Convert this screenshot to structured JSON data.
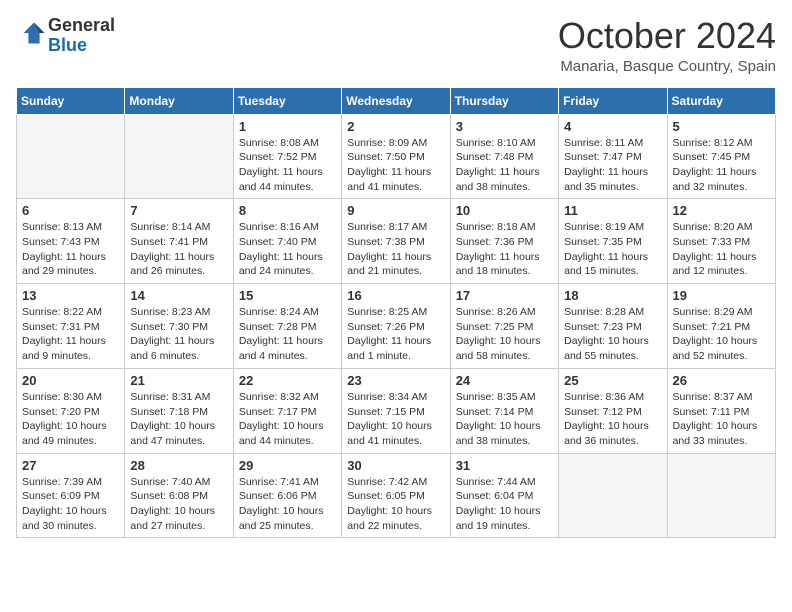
{
  "header": {
    "logo": {
      "line1": "General",
      "line2": "Blue"
    },
    "title": "October 2024",
    "location": "Manaria, Basque Country, Spain"
  },
  "days_of_week": [
    "Sunday",
    "Monday",
    "Tuesday",
    "Wednesday",
    "Thursday",
    "Friday",
    "Saturday"
  ],
  "weeks": [
    [
      {
        "day": "",
        "detail": ""
      },
      {
        "day": "",
        "detail": ""
      },
      {
        "day": "1",
        "detail": "Sunrise: 8:08 AM\nSunset: 7:52 PM\nDaylight: 11 hours and 44 minutes."
      },
      {
        "day": "2",
        "detail": "Sunrise: 8:09 AM\nSunset: 7:50 PM\nDaylight: 11 hours and 41 minutes."
      },
      {
        "day": "3",
        "detail": "Sunrise: 8:10 AM\nSunset: 7:48 PM\nDaylight: 11 hours and 38 minutes."
      },
      {
        "day": "4",
        "detail": "Sunrise: 8:11 AM\nSunset: 7:47 PM\nDaylight: 11 hours and 35 minutes."
      },
      {
        "day": "5",
        "detail": "Sunrise: 8:12 AM\nSunset: 7:45 PM\nDaylight: 11 hours and 32 minutes."
      }
    ],
    [
      {
        "day": "6",
        "detail": "Sunrise: 8:13 AM\nSunset: 7:43 PM\nDaylight: 11 hours and 29 minutes."
      },
      {
        "day": "7",
        "detail": "Sunrise: 8:14 AM\nSunset: 7:41 PM\nDaylight: 11 hours and 26 minutes."
      },
      {
        "day": "8",
        "detail": "Sunrise: 8:16 AM\nSunset: 7:40 PM\nDaylight: 11 hours and 24 minutes."
      },
      {
        "day": "9",
        "detail": "Sunrise: 8:17 AM\nSunset: 7:38 PM\nDaylight: 11 hours and 21 minutes."
      },
      {
        "day": "10",
        "detail": "Sunrise: 8:18 AM\nSunset: 7:36 PM\nDaylight: 11 hours and 18 minutes."
      },
      {
        "day": "11",
        "detail": "Sunrise: 8:19 AM\nSunset: 7:35 PM\nDaylight: 11 hours and 15 minutes."
      },
      {
        "day": "12",
        "detail": "Sunrise: 8:20 AM\nSunset: 7:33 PM\nDaylight: 11 hours and 12 minutes."
      }
    ],
    [
      {
        "day": "13",
        "detail": "Sunrise: 8:22 AM\nSunset: 7:31 PM\nDaylight: 11 hours and 9 minutes."
      },
      {
        "day": "14",
        "detail": "Sunrise: 8:23 AM\nSunset: 7:30 PM\nDaylight: 11 hours and 6 minutes."
      },
      {
        "day": "15",
        "detail": "Sunrise: 8:24 AM\nSunset: 7:28 PM\nDaylight: 11 hours and 4 minutes."
      },
      {
        "day": "16",
        "detail": "Sunrise: 8:25 AM\nSunset: 7:26 PM\nDaylight: 11 hours and 1 minute."
      },
      {
        "day": "17",
        "detail": "Sunrise: 8:26 AM\nSunset: 7:25 PM\nDaylight: 10 hours and 58 minutes."
      },
      {
        "day": "18",
        "detail": "Sunrise: 8:28 AM\nSunset: 7:23 PM\nDaylight: 10 hours and 55 minutes."
      },
      {
        "day": "19",
        "detail": "Sunrise: 8:29 AM\nSunset: 7:21 PM\nDaylight: 10 hours and 52 minutes."
      }
    ],
    [
      {
        "day": "20",
        "detail": "Sunrise: 8:30 AM\nSunset: 7:20 PM\nDaylight: 10 hours and 49 minutes."
      },
      {
        "day": "21",
        "detail": "Sunrise: 8:31 AM\nSunset: 7:18 PM\nDaylight: 10 hours and 47 minutes."
      },
      {
        "day": "22",
        "detail": "Sunrise: 8:32 AM\nSunset: 7:17 PM\nDaylight: 10 hours and 44 minutes."
      },
      {
        "day": "23",
        "detail": "Sunrise: 8:34 AM\nSunset: 7:15 PM\nDaylight: 10 hours and 41 minutes."
      },
      {
        "day": "24",
        "detail": "Sunrise: 8:35 AM\nSunset: 7:14 PM\nDaylight: 10 hours and 38 minutes."
      },
      {
        "day": "25",
        "detail": "Sunrise: 8:36 AM\nSunset: 7:12 PM\nDaylight: 10 hours and 36 minutes."
      },
      {
        "day": "26",
        "detail": "Sunrise: 8:37 AM\nSunset: 7:11 PM\nDaylight: 10 hours and 33 minutes."
      }
    ],
    [
      {
        "day": "27",
        "detail": "Sunrise: 7:39 AM\nSunset: 6:09 PM\nDaylight: 10 hours and 30 minutes."
      },
      {
        "day": "28",
        "detail": "Sunrise: 7:40 AM\nSunset: 6:08 PM\nDaylight: 10 hours and 27 minutes."
      },
      {
        "day": "29",
        "detail": "Sunrise: 7:41 AM\nSunset: 6:06 PM\nDaylight: 10 hours and 25 minutes."
      },
      {
        "day": "30",
        "detail": "Sunrise: 7:42 AM\nSunset: 6:05 PM\nDaylight: 10 hours and 22 minutes."
      },
      {
        "day": "31",
        "detail": "Sunrise: 7:44 AM\nSunset: 6:04 PM\nDaylight: 10 hours and 19 minutes."
      },
      {
        "day": "",
        "detail": ""
      },
      {
        "day": "",
        "detail": ""
      }
    ]
  ]
}
